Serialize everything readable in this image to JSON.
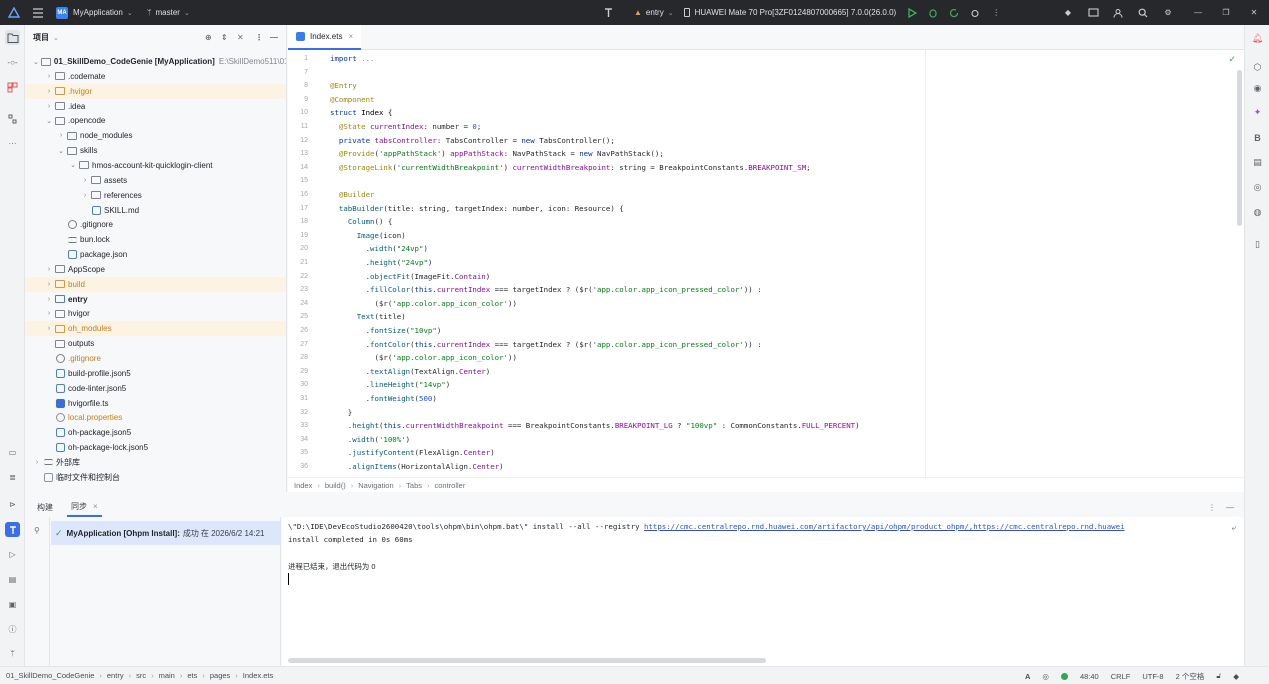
{
  "titlebar": {
    "project_name": "MyApplication",
    "project_initials": "MA",
    "branch": "master",
    "module": "entry",
    "device": "HUAWEI Mate 70 Pro[3ZF0124807000665] 7.0.0(26.0.0)"
  },
  "project_panel": {
    "title": "项目",
    "tree": [
      {
        "label": "01_SkillDemo_CodeGenie [MyApplication]",
        "path": "E:\\SkillDemo511\\01",
        "depth": 0,
        "expanded": true,
        "icon": "folder",
        "bold": true
      },
      {
        "label": ".codemate",
        "depth": 1,
        "icon": "folder"
      },
      {
        "label": ".hvigor",
        "depth": 1,
        "icon": "folder-orange",
        "highlight": true,
        "color": "orange"
      },
      {
        "label": ".idea",
        "depth": 1,
        "icon": "folder"
      },
      {
        "label": ".opencode",
        "depth": 1,
        "expanded": true,
        "icon": "folder"
      },
      {
        "label": "node_modules",
        "depth": 2,
        "icon": "folder"
      },
      {
        "label": "skills",
        "depth": 2,
        "expanded": true,
        "icon": "folder"
      },
      {
        "label": "hmos-account-kit-quicklogin-client",
        "depth": 3,
        "expanded": true,
        "icon": "folder"
      },
      {
        "label": "assets",
        "depth": 4,
        "icon": "folder"
      },
      {
        "label": "references",
        "depth": 4,
        "icon": "folder"
      },
      {
        "label": "SKILL.md",
        "depth": 4,
        "icon": "markdown",
        "leaf": true
      },
      {
        "label": ".gitignore",
        "depth": 2,
        "icon": "ban",
        "leaf": true
      },
      {
        "label": "bun.lock",
        "depth": 2,
        "icon": "lines",
        "leaf": true
      },
      {
        "label": "package.json",
        "depth": 2,
        "icon": "json",
        "leaf": true
      },
      {
        "label": "AppScope",
        "depth": 1,
        "icon": "folder"
      },
      {
        "label": "build",
        "depth": 1,
        "icon": "folder-orange",
        "highlight": true,
        "color": "orange"
      },
      {
        "label": "entry",
        "depth": 1,
        "icon": "folder-blue",
        "bold": true
      },
      {
        "label": "hvigor",
        "depth": 1,
        "icon": "folder"
      },
      {
        "label": "oh_modules",
        "depth": 1,
        "icon": "folder-orange",
        "highlight": true,
        "color": "orange"
      },
      {
        "label": "outputs",
        "depth": 1,
        "icon": "folder",
        "leaf": true
      },
      {
        "label": ".gitignore",
        "depth": 1,
        "icon": "ban",
        "leaf": true,
        "color": "orange"
      },
      {
        "label": "build-profile.json5",
        "depth": 1,
        "icon": "json",
        "leaf": true
      },
      {
        "label": "code-linter.json5",
        "depth": 1,
        "icon": "json",
        "leaf": true
      },
      {
        "label": "hvigorfile.ts",
        "depth": 1,
        "icon": "ts",
        "leaf": true
      },
      {
        "label": "local.properties",
        "depth": 1,
        "icon": "gear",
        "leaf": true,
        "color": "orange"
      },
      {
        "label": "oh-package.json5",
        "depth": 1,
        "icon": "json",
        "leaf": true
      },
      {
        "label": "oh-package-lock.json5",
        "depth": 1,
        "icon": "json",
        "leaf": true
      },
      {
        "label": "外部库",
        "depth": 0,
        "icon": "library"
      },
      {
        "label": "临时文件和控制台",
        "depth": 0,
        "icon": "scratch",
        "leaf": true
      }
    ]
  },
  "editor": {
    "tab_label": "Index.ets",
    "line_numbers": [
      "1",
      "7",
      "8",
      "9",
      "10",
      "11",
      "12",
      "13",
      "14",
      "15",
      "16",
      "17",
      "18",
      "19",
      "20",
      "21",
      "22",
      "23",
      "24",
      "25",
      "26",
      "27",
      "28",
      "29",
      "30",
      "31",
      "32",
      "33",
      "34",
      "35",
      "36"
    ],
    "code_lines": [
      [
        [
          "k",
          "import "
        ],
        [
          "fold",
          "..."
        ]
      ],
      [],
      [
        [
          "dec",
          "@Entry"
        ]
      ],
      [
        [
          "dec",
          "@Component"
        ]
      ],
      [
        [
          "k",
          "struct "
        ],
        [
          "ty",
          "Index {"
        ]
      ],
      [
        [
          "t",
          "  "
        ],
        [
          "dec",
          "@State "
        ],
        [
          "fld",
          "currentIndex"
        ],
        [
          "t",
          ": number = "
        ],
        [
          "num",
          "0"
        ],
        [
          "t",
          ";"
        ]
      ],
      [
        [
          "t",
          "  "
        ],
        [
          "k",
          "private "
        ],
        [
          "fld",
          "tabsController"
        ],
        [
          "t",
          ": TabsController = "
        ],
        [
          "k",
          "new "
        ],
        [
          "t",
          "TabsController();"
        ]
      ],
      [
        [
          "t",
          "  "
        ],
        [
          "dec",
          "@Provide"
        ],
        [
          "t",
          "("
        ],
        [
          "str",
          "'appPathStack'"
        ],
        [
          "t",
          ") "
        ],
        [
          "fld",
          "appPathStack"
        ],
        [
          "t",
          ": NavPathStack = "
        ],
        [
          "k",
          "new "
        ],
        [
          "t",
          "NavPathStack();"
        ]
      ],
      [
        [
          "t",
          "  "
        ],
        [
          "dec",
          "@StorageLink"
        ],
        [
          "t",
          "("
        ],
        [
          "str",
          "'currentWidthBreakpoint'"
        ],
        [
          "t",
          ") "
        ],
        [
          "fld",
          "currentWidthBreakpoint"
        ],
        [
          "t",
          ": string = BreakpointConstants."
        ],
        [
          "fld",
          "BREAKPOINT_SM"
        ],
        [
          "t",
          ";"
        ]
      ],
      [],
      [
        [
          "t",
          "  "
        ],
        [
          "dec",
          "@Builder"
        ]
      ],
      [
        [
          "t",
          "  "
        ],
        [
          "fn",
          "tabBuilder"
        ],
        [
          "t",
          "(title: string, targetIndex: number, icon: Resource) {"
        ]
      ],
      [
        [
          "t",
          "    "
        ],
        [
          "fn",
          "Column"
        ],
        [
          "t",
          "() {"
        ]
      ],
      [
        [
          "t",
          "      "
        ],
        [
          "fn",
          "Image"
        ],
        [
          "t",
          "(icon)"
        ]
      ],
      [
        [
          "t",
          "        ."
        ],
        [
          "fn",
          "width"
        ],
        [
          "t",
          "("
        ],
        [
          "str",
          "\"24vp\""
        ],
        [
          "t",
          ")"
        ]
      ],
      [
        [
          "t",
          "        ."
        ],
        [
          "fn",
          "height"
        ],
        [
          "t",
          "("
        ],
        [
          "str",
          "\"24vp\""
        ],
        [
          "t",
          ")"
        ]
      ],
      [
        [
          "t",
          "        ."
        ],
        [
          "fn",
          "objectFit"
        ],
        [
          "t",
          "(ImageFit."
        ],
        [
          "fld",
          "Contain"
        ],
        [
          "t",
          ")"
        ]
      ],
      [
        [
          "t",
          "        ."
        ],
        [
          "fn",
          "fillColor"
        ],
        [
          "t",
          "("
        ],
        [
          "k",
          "this"
        ],
        [
          "t",
          "."
        ],
        [
          "fld",
          "currentIndex"
        ],
        [
          "t",
          " === targetIndex ? ($r("
        ],
        [
          "str",
          "'app.color.app_icon_pressed_color'"
        ],
        [
          "t",
          ")) :"
        ]
      ],
      [
        [
          "t",
          "          ($r("
        ],
        [
          "str",
          "'app.color.app_icon_color'"
        ],
        [
          "t",
          "))"
        ]
      ],
      [
        [
          "t",
          "      "
        ],
        [
          "fn",
          "Text"
        ],
        [
          "t",
          "(title)"
        ]
      ],
      [
        [
          "t",
          "        ."
        ],
        [
          "fn",
          "fontSize"
        ],
        [
          "t",
          "("
        ],
        [
          "str",
          "\"10vp\""
        ],
        [
          "t",
          ")"
        ]
      ],
      [
        [
          "t",
          "        ."
        ],
        [
          "fn",
          "fontColor"
        ],
        [
          "t",
          "("
        ],
        [
          "k",
          "this"
        ],
        [
          "t",
          "."
        ],
        [
          "fld",
          "currentIndex"
        ],
        [
          "t",
          " === targetIndex ? ($r("
        ],
        [
          "str",
          "'app.color.app_icon_pressed_color'"
        ],
        [
          "t",
          ")) :"
        ]
      ],
      [
        [
          "t",
          "          ($r("
        ],
        [
          "str",
          "'app.color.app_icon_color'"
        ],
        [
          "t",
          "))"
        ]
      ],
      [
        [
          "t",
          "        ."
        ],
        [
          "fn",
          "textAlign"
        ],
        [
          "t",
          "(TextAlign."
        ],
        [
          "fld",
          "Center"
        ],
        [
          "t",
          ")"
        ]
      ],
      [
        [
          "t",
          "        ."
        ],
        [
          "fn",
          "lineHeight"
        ],
        [
          "t",
          "("
        ],
        [
          "str",
          "\"14vp\""
        ],
        [
          "t",
          ")"
        ]
      ],
      [
        [
          "t",
          "        ."
        ],
        [
          "fn",
          "fontWeight"
        ],
        [
          "t",
          "("
        ],
        [
          "num",
          "500"
        ],
        [
          "t",
          ")"
        ]
      ],
      [
        [
          "t",
          "    }"
        ]
      ],
      [
        [
          "t",
          "    ."
        ],
        [
          "fn",
          "height"
        ],
        [
          "t",
          "("
        ],
        [
          "k",
          "this"
        ],
        [
          "t",
          "."
        ],
        [
          "fld",
          "currentWidthBreakpoint"
        ],
        [
          "t",
          " === BreakpointConstants."
        ],
        [
          "fld",
          "BREAKPOINT_LG"
        ],
        [
          "t",
          " ? "
        ],
        [
          "str",
          "\"100vp\""
        ],
        [
          "t",
          " : CommonConstants."
        ],
        [
          "fld",
          "FULL_PERCENT"
        ],
        [
          "t",
          ")"
        ]
      ],
      [
        [
          "t",
          "    ."
        ],
        [
          "fn",
          "width"
        ],
        [
          "t",
          "("
        ],
        [
          "str",
          "'100%'"
        ],
        [
          "t",
          ")"
        ]
      ],
      [
        [
          "t",
          "    ."
        ],
        [
          "fn",
          "justifyContent"
        ],
        [
          "t",
          "(FlexAlign."
        ],
        [
          "fld",
          "Center"
        ],
        [
          "t",
          ")"
        ]
      ],
      [
        [
          "t",
          "    ."
        ],
        [
          "fn",
          "alignItems"
        ],
        [
          "t",
          "(HorizontalAlign."
        ],
        [
          "fld",
          "Center"
        ],
        [
          "t",
          ")"
        ]
      ]
    ],
    "breadcrumb": [
      "Index",
      "build()",
      "Navigation",
      "Tabs",
      "controller"
    ]
  },
  "bottom_panel": {
    "tabs": [
      "构建",
      "同步"
    ],
    "build_entry": {
      "title": "MyApplication [Ohpm Install]:",
      "status": "成功",
      "time": "在 2026/6/2 14:21"
    },
    "console": {
      "command_prefix": "\\\"D:\\IDE\\DevEcoStudio2600420\\tools\\ohpm\\bin\\ohpm.bat\\\" install --all --registry ",
      "command_link": "https://cmc.centralrepo.rnd.huawei.com/artifactory/api/ohpm/product_ohpm/,https://cmc.centralrepo.rnd.huawei",
      "line2": "install completed in 0s 60ms",
      "line3": "进程已结束，退出代码为 0"
    }
  },
  "statusbar": {
    "path": [
      "01_SkillDemo_CodeGenie",
      "entry",
      "src",
      "main",
      "ets",
      "pages",
      "Index.ets"
    ],
    "position": "48:40",
    "line_ending": "CRLF",
    "encoding": "UTF-8",
    "indent": "2 个空格"
  },
  "colors": {
    "accent": "#3a6df0",
    "titlebar_bg": "#27282c",
    "run_green": "#2fa84f"
  }
}
